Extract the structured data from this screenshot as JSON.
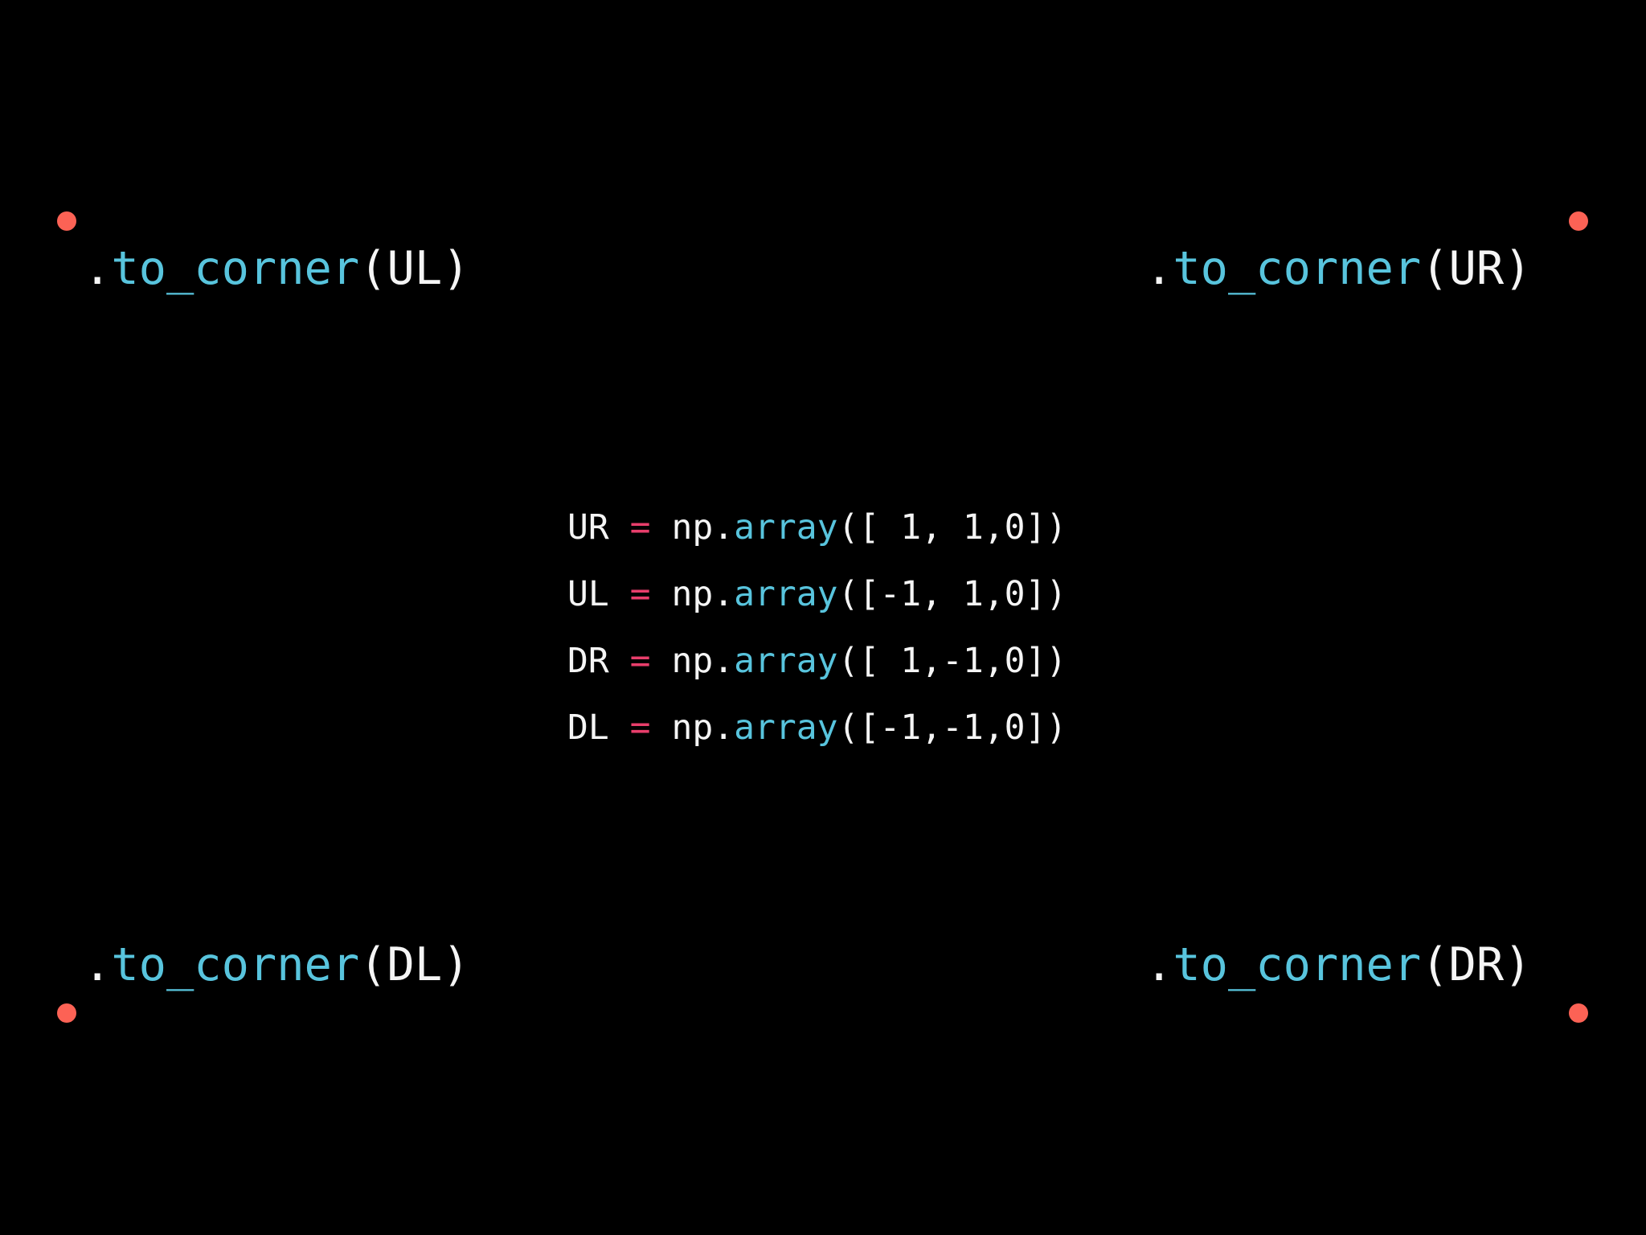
{
  "colors": {
    "background": "#000000",
    "dot": "#fc6255",
    "text": "#f5f5f5",
    "method": "#58c4dd",
    "operator": "#e83e6b"
  },
  "corner_labels": {
    "ul": {
      "dot": ".",
      "method": "to_corner",
      "open": "(",
      "arg": "UL",
      "close": ")"
    },
    "ur": {
      "dot": ".",
      "method": "to_corner",
      "open": "(",
      "arg": "UR",
      "close": ")"
    },
    "dl": {
      "dot": ".",
      "method": "to_corner",
      "open": "(",
      "arg": "DL",
      "close": ")"
    },
    "dr": {
      "dot": ".",
      "method": "to_corner",
      "open": "(",
      "arg": "DR",
      "close": ")"
    }
  },
  "code": {
    "lines": [
      {
        "name": "UR",
        "eq": "=",
        "module": "np.",
        "func": "array",
        "args": "([ 1, 1,0])"
      },
      {
        "name": "UL",
        "eq": "=",
        "module": "np.",
        "func": "array",
        "args": "([-1, 1,0])"
      },
      {
        "name": "DR",
        "eq": "=",
        "module": "np.",
        "func": "array",
        "args": "([ 1,-1,0])"
      },
      {
        "name": "DL",
        "eq": "=",
        "module": "np.",
        "func": "array",
        "args": "([-1,-1,0])"
      }
    ]
  }
}
